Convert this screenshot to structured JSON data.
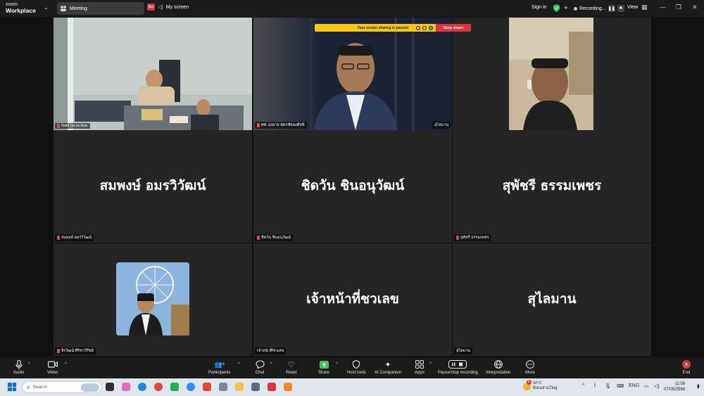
{
  "titlebar": {
    "logo_line1": "zoom",
    "logo_line2": "Workplace",
    "meeting_tab": "Meeting",
    "my_screen": "My screen",
    "my_screen_badge": "fax",
    "sign_in": "Sign in",
    "recording": "Recording...",
    "view": "View"
  },
  "share_bar": {
    "paused_text": "Your screen sharing is paused",
    "stop_label": "Stop share"
  },
  "tiles": [
    {
      "name": "Natti na-ra-Ree",
      "big_name": "",
      "muted": true,
      "active": true
    },
    {
      "name": "ศศ. องอาจ ฉัตรชัยพงศ์ทนี",
      "big_name": "",
      "muted": true,
      "active": false
    },
    {
      "name": "สุไลมาน",
      "big_name": "",
      "muted": false,
      "active": false
    },
    {
      "name": "สมพงษ์ อมรวิวัฒน์",
      "big_name": "สมพงษ์ อมรวิวัฒน์",
      "muted": true,
      "active": false
    },
    {
      "name": "ชิดวัน ชินอนุวัฒน์",
      "big_name": "ชิดวัน ชินอนุวัฒน์",
      "muted": true,
      "active": false
    },
    {
      "name": "สุพัชรี ธรรมเพชร",
      "big_name": "สุพัชรี ธรรมเพชร",
      "muted": true,
      "active": false
    },
    {
      "name": "จิรวัฒน์ ศิริชาวีรัชย์",
      "big_name": "",
      "muted": true,
      "active": false
    },
    {
      "name": "เจ้าหน้าที่ชวเลข",
      "big_name": "เจ้าหน้าที่ชวเลข",
      "muted": false,
      "active": false
    },
    {
      "name": "สุไลมาน",
      "big_name": "สุไลมาน",
      "muted": false,
      "active": false
    }
  ],
  "toolbar": {
    "audio": "Audio",
    "video": "Video",
    "participants": "Participants",
    "participants_count": "9",
    "chat": "Chat",
    "react": "React",
    "share": "Share",
    "host_tools": "Host tools",
    "ai_companion": "AI Companion",
    "apps": "Apps",
    "pause_recording": "Pause/stop recording",
    "interpretation": "Interpretation",
    "more": "More",
    "end": "End"
  },
  "taskbar": {
    "search_placeholder": "Search",
    "weather_temp": "32°C",
    "weather_desc": "มีเมฆส่วนใหญ่",
    "weather_badge": "6",
    "lang": "ENG",
    "time": "11:08",
    "date": "07/05/2568"
  },
  "colors": {
    "active_outline": "#3ec45b",
    "share_paused": "#f5c518",
    "stop_share": "#d9363e",
    "toolbar_bg": "#1b1b1b",
    "taskbar_bg": "#dfe6ee"
  }
}
